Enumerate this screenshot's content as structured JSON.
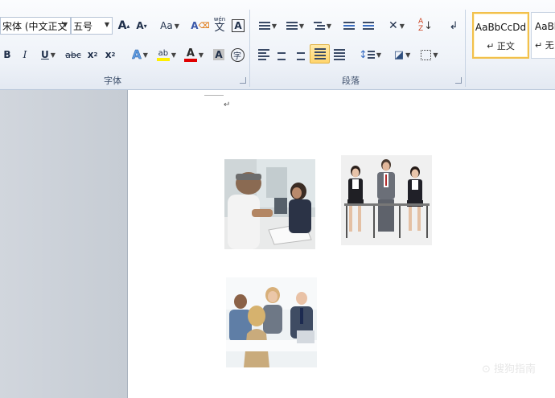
{
  "font_group": {
    "label": "字体",
    "font_name": "宋体 (中文正文",
    "font_size": "五号",
    "grow": "A",
    "shrink": "A",
    "change_case": "Aa",
    "clear_format": "A",
    "phonetic_top": "wén",
    "phonetic_char": "文",
    "border_char": "A",
    "bold": "B",
    "italic": "I",
    "underline": "U",
    "strike": "abc",
    "subscript": "x",
    "superscript": "x",
    "effects": "A",
    "highlight": "ab",
    "font_color": "A",
    "shading": "A",
    "enclose": "字"
  },
  "paragraph_group": {
    "label": "段落",
    "sort": "A"
  },
  "styles_group": {
    "items": [
      {
        "sample": "AaBbCcDd",
        "name": "↵ 正文"
      },
      {
        "sample": "AaBb",
        "name": "↵ 无"
      }
    ]
  },
  "document": {
    "paragraph_mark": "↵",
    "watermark": "⊙ 搜狗指南"
  },
  "colors": {
    "highlight": "#ffef00",
    "font_color": "#e00000",
    "selected_style": "#f2c04c"
  }
}
